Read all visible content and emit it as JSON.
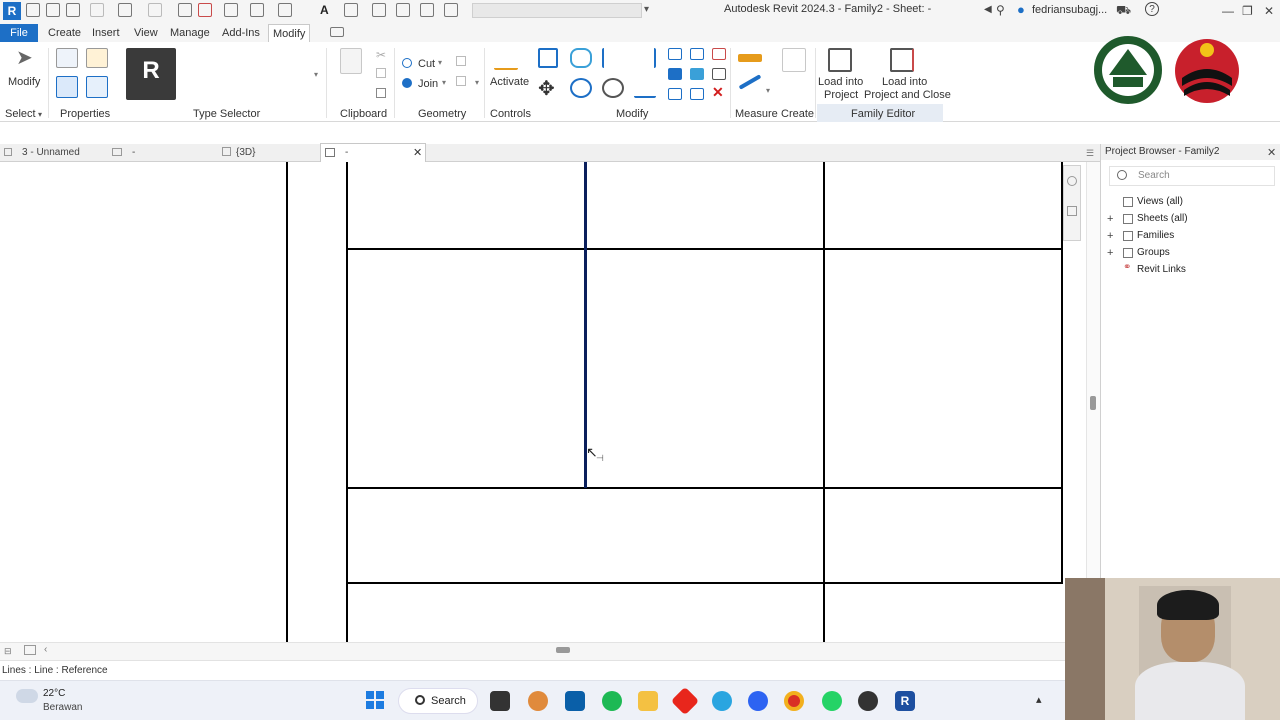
{
  "app": {
    "badge": "R",
    "window_title": "Autodesk Revit 2024.3 - Family2 - Sheet: -",
    "user": "fedriansubagj..."
  },
  "ribbon_tabs": [
    "File",
    "Create",
    "Insert",
    "View",
    "Manage",
    "Add-Ins",
    "Modify"
  ],
  "ribbon": {
    "modify_label": "Modify",
    "select_label": "Select",
    "properties_label": "Properties",
    "type_selector_label": "Type Selector",
    "clipboard_label": "Clipboard",
    "geometry_label": "Geometry",
    "cut_label": "Cut",
    "join_label": "Join",
    "activate_label": "Activate",
    "controls_label": "Controls",
    "modify_panel_label": "Modify",
    "measure_label": "Measure",
    "create_label": "Create",
    "load_into_project": [
      "Load into",
      "Project"
    ],
    "load_into_project_close": [
      "Load into",
      "Project and Close"
    ],
    "family_editor_label": "Family Editor"
  },
  "view_tabs": {
    "tab1": "3 - Unnamed",
    "tab2": "-",
    "tab3": "{3D}",
    "tab4": "-"
  },
  "project_browser": {
    "title": "Project Browser - Family2",
    "search_placeholder": "Search",
    "items": [
      "Views (all)",
      "Sheets (all)",
      "Families",
      "Groups",
      "Revit Links"
    ]
  },
  "status_bar": {
    "text": "Lines : Line : Reference"
  },
  "taskbar": {
    "weather_temp": "22°C",
    "weather_desc": "Berawan",
    "search_label": "Search"
  },
  "colors": {
    "accent": "#1d6fc6",
    "selected_line": "#0a1f5c"
  }
}
